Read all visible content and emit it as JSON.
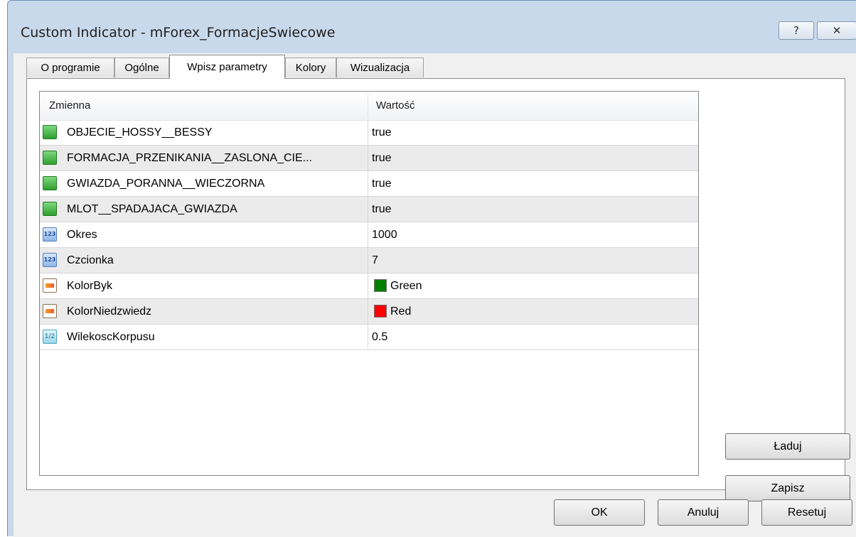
{
  "window": {
    "title": "Custom Indicator - mForex_FormacjeSwiecowe",
    "help_label": "?",
    "close_label": "✕"
  },
  "tabs": [
    {
      "label": "O programie",
      "active": false
    },
    {
      "label": "Ogólne",
      "active": false
    },
    {
      "label": "Wpisz parametry",
      "active": true
    },
    {
      "label": "Kolory",
      "active": false
    },
    {
      "label": "Wizualizacja",
      "active": false
    }
  ],
  "table": {
    "col_name": "Zmienna",
    "col_value": "Wartość",
    "rows": [
      {
        "icon": "bool-icon",
        "name": "OBJECIE_HOSSY__BESSY",
        "value": "true"
      },
      {
        "icon": "bool-icon",
        "name": "FORMACJA_PRZENIKANIA__ZASLONA_CIE...",
        "value": "true"
      },
      {
        "icon": "bool-icon",
        "name": "GWIAZDA_PORANNA__WIECZORNA",
        "value": "true"
      },
      {
        "icon": "bool-icon",
        "name": "MLOT__SPADAJACA_GWIAZDA",
        "value": "true"
      },
      {
        "icon": "integer-icon",
        "name": "Okres",
        "value": "1000"
      },
      {
        "icon": "integer-icon",
        "name": "Czcionka",
        "value": "7"
      },
      {
        "icon": "color-icon",
        "name": "KolorByk",
        "value": "Green",
        "swatch": "#008000"
      },
      {
        "icon": "color-icon",
        "name": "KolorNiedzwiedz",
        "value": "Red",
        "swatch": "#ff0000"
      },
      {
        "icon": "double-icon",
        "name": "WilekoscKorpusu",
        "value": "0.5"
      }
    ]
  },
  "icon_text": {
    "integer": "123",
    "double": "1/2"
  },
  "buttons": {
    "load": "Ładuj",
    "save": "Zapisz",
    "ok": "OK",
    "cancel": "Anuluj",
    "reset": "Resetuj"
  }
}
